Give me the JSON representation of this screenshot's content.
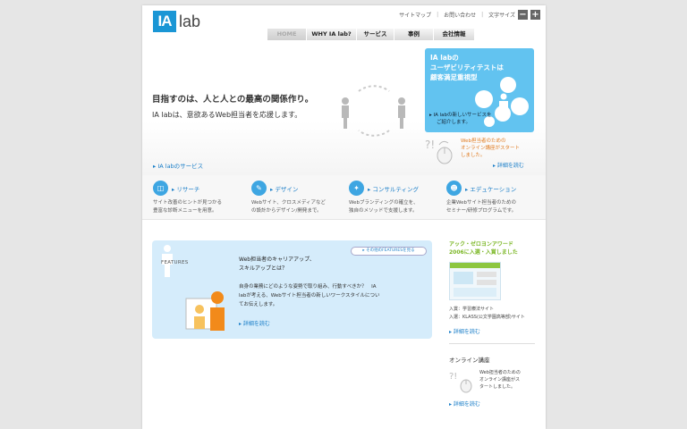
{
  "header": {
    "logo_box": "IA",
    "logo_text": "lab",
    "util": {
      "sitemap": "サイトマップ",
      "contact": "お問い合わせ",
      "font_size": "文字サイズ",
      "minus": "−",
      "plus": "+"
    },
    "nav": [
      {
        "label": "HOME",
        "active": true
      },
      {
        "label": "WHY IA lab?",
        "active": false
      },
      {
        "label": "サービス",
        "active": false
      },
      {
        "label": "事例",
        "active": false
      },
      {
        "label": "会社情報",
        "active": false
      }
    ]
  },
  "hero": {
    "line1": "目指すのは、人と人との最高の関係作り。",
    "line2": "IA labは、意欲あるWeb担当者を応援します。",
    "services_link": "▸ IA labのサービス",
    "promo": {
      "title1": "IA labの",
      "title2": "ユーザビリティテストは",
      "title3": "顧客満足重視型",
      "desc1": "▸ IA labの新しいサービスを",
      "desc2": "ご紹介します。"
    },
    "online": {
      "line1": "Web担当者のための",
      "line2": "オンライン講座がスタート",
      "line3": "しました。"
    },
    "detail_link": "▸ 詳細を読む"
  },
  "services": [
    {
      "icon": "research-icon",
      "title": "▸ リサーチ",
      "desc1": "サイト改善のヒントが見つかる",
      "desc2": "豊富な診断メニューを用意。"
    },
    {
      "icon": "design-icon",
      "title": "▸ デザイン",
      "desc1": "Webサイト、クロスメディアなど",
      "desc2": "の設計からデザイン/開発まで。"
    },
    {
      "icon": "consulting-icon",
      "title": "▸ コンサルティング",
      "desc1": "Webブランディングの確立を、",
      "desc2": "独自のメソッドで支援します。"
    },
    {
      "icon": "education-icon",
      "title": "▸ エデュケーション",
      "desc1": "企業Webサイト担当者のための",
      "desc2": "セミナー/研修プログラムです。"
    }
  ],
  "features": {
    "label": "FEATURES",
    "more": "▸ その他のFEATURESを見る",
    "title1": "Web担当者のキャリアアップ、",
    "title2": "スキルアップとは？",
    "body1": "自身の業務にどのような姿勢で取り組み、行動すべきか？　IA",
    "body2": "labが考える、Webサイト担当者の新しいワークスタイルについ",
    "body3": "てお伝えします。",
    "detail": "▸ 詳細を読む"
  },
  "sidebar": {
    "award_title1": "アック・ゼロヨンアワード",
    "award_title2": "2006に入選・入賞しました",
    "award_text1": "入賞：学習療法サイト",
    "award_text2": "入選：KLASS(公文学園高等部)サイト",
    "award_link": "▸ 詳細を読む",
    "online_head": "オンライン講座",
    "online_text1": "Web担当者のための",
    "online_text2": "オンライン講座がス",
    "online_text3": "タートしました。",
    "online_link": "▸ 詳細を読む"
  },
  "colors": {
    "brand": "#1a96d5",
    "link": "#1a7ec8",
    "promo_bg": "#62c3f0",
    "features_bg": "#d5ecfb",
    "award_green": "#7cb726",
    "online_orange": "#e07b20"
  }
}
